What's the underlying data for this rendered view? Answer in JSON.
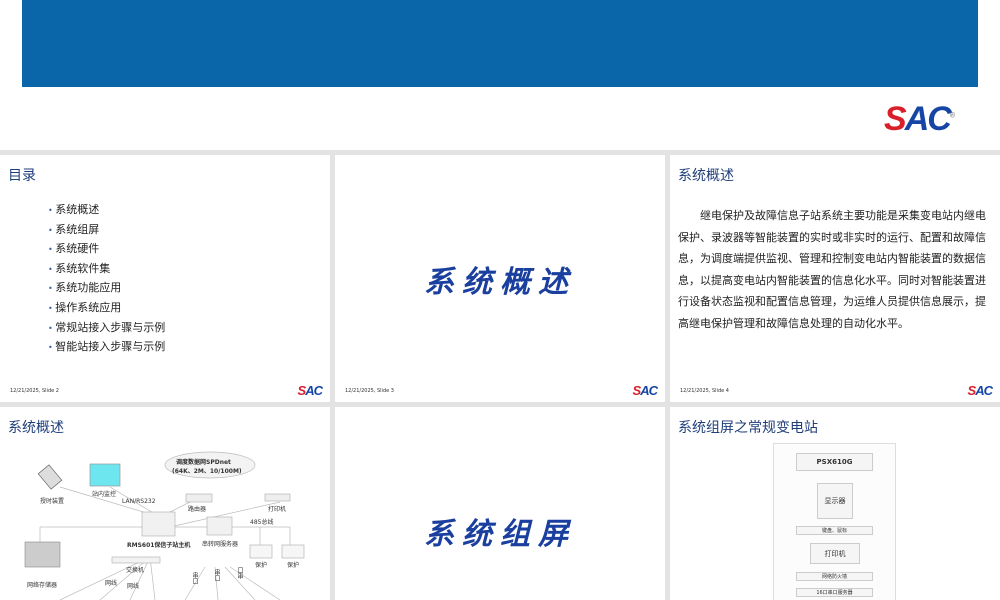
{
  "header": {
    "logo": "SAC"
  },
  "slides": [
    {
      "id": 2,
      "title": "目录",
      "items": [
        "系统概述",
        "系统组屏",
        "系统硬件",
        "系统软件集",
        "系统功能应用",
        "操作系统应用",
        "常规站接入步骤与示例",
        "智能站接入步骤与示例"
      ],
      "footer": "12/21/2025, Slide 2"
    },
    {
      "id": 3,
      "section": "系统概述",
      "footer": "12/21/2025, Slide 3"
    },
    {
      "id": 4,
      "title": "系统概述",
      "text": "继电保护及故障信息子站系统主要功能是采集变电站内继电保护、录波器等智能装置的实时或非实时的运行、配置和故障信息，为调度端提供监视、管理和控制变电站内智能装置的数据信息，以提高变电站内智能装置的信息化水平。同时对智能装置进行设备状态监视和配置信息管理，为运维人员提供信息展示，提高继电保护管理和故障信息处理的自动化水平。",
      "footer": "12/21/2025, Slide 4"
    },
    {
      "id": 5,
      "title": "系统概述",
      "diagram": {
        "cloud": "调度数据网SPDnet",
        "cloud_sub": "(64K、2M、10/100M)",
        "gps": "授时装置",
        "monitor": "站内监控",
        "lan": "LAN/RS232",
        "router": "路由器",
        "printer": "打印机",
        "host": "RMS601保信子站主机",
        "server": "串转网服务器",
        "bus": "485总线",
        "prot1": "保护",
        "prot2": "保护",
        "switch": "交换机",
        "storage": "网络存储器",
        "net1": "网线",
        "net2": "网线",
        "s1": "串口",
        "s2": "串口",
        "s3": "口串"
      }
    },
    {
      "id": 6,
      "section": "系统组屏"
    },
    {
      "id": 7,
      "title": "系统组屏之常规变电站",
      "cabinet": [
        "PSX610G",
        "显示器",
        "键盘、鼠标",
        "打印机",
        "网络防火墙",
        "16口串口服务器"
      ]
    }
  ]
}
